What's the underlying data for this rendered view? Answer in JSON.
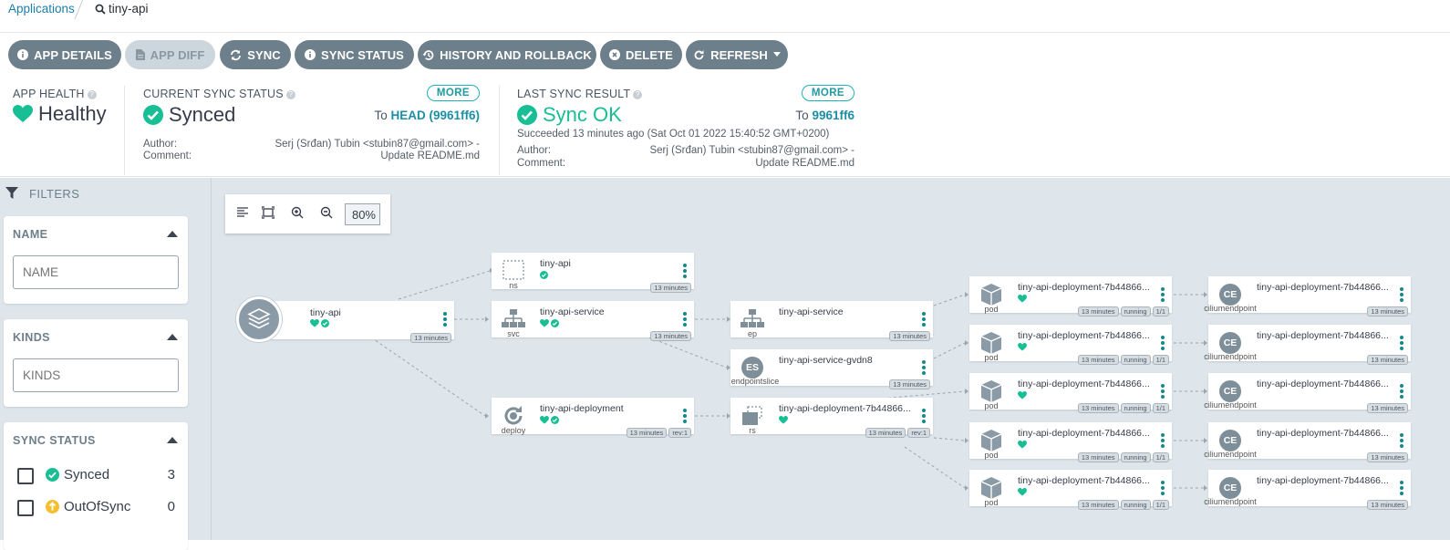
{
  "breadcrumb": {
    "applications": "Applications",
    "current": "tiny-api"
  },
  "toolbar": {
    "app_details": "APP DETAILS",
    "app_diff": "APP DIFF",
    "sync": "SYNC",
    "sync_status": "SYNC STATUS",
    "history": "HISTORY AND ROLLBACK",
    "delete": "DELETE",
    "refresh": "REFRESH"
  },
  "health": {
    "label": "APP HEALTH",
    "value": "Healthy"
  },
  "current_sync": {
    "label": "CURRENT SYNC STATUS",
    "value": "Synced",
    "more": "MORE",
    "to_prefix": "To",
    "to_ref": "HEAD (9961ff6)",
    "author_label": "Author:",
    "author": "Serj (Srđan) Tubin <stubin87@gmail.com> -",
    "comment_label": "Comment:",
    "comment": "Update README.md"
  },
  "last_sync": {
    "label": "LAST SYNC RESULT",
    "value": "Sync OK",
    "more": "MORE",
    "to_prefix": "To",
    "to_ref": "9961ff6",
    "succeeded": "Succeeded 13 minutes ago (Sat Oct 01 2022 15:40:52 GMT+0200)",
    "author_label": "Author:",
    "author": "Serj (Srđan) Tubin <stubin87@gmail.com> -",
    "comment_label": "Comment:",
    "comment": "Update README.md"
  },
  "filters": {
    "title": "FILTERS",
    "name": {
      "title": "NAME",
      "placeholder": "NAME"
    },
    "kinds": {
      "title": "KINDS",
      "placeholder": "KINDS"
    },
    "sync_status": {
      "title": "SYNC STATUS",
      "items": [
        {
          "label": "Synced",
          "count": "3"
        },
        {
          "label": "OutOfSync",
          "count": "0"
        }
      ]
    }
  },
  "zoom": "80%",
  "colors": {
    "accent": "#18be94",
    "button": "#6d7f8b",
    "link": "#1c8fa6",
    "outofsync": "#f4c030"
  },
  "graph": {
    "app": {
      "name": "tiny-api",
      "age": "13 minutes"
    },
    "ns": {
      "name": "tiny-api",
      "kind": "ns",
      "age": "13 minutes"
    },
    "svc": {
      "name": "tiny-api-service",
      "kind": "svc",
      "age": "13 minutes"
    },
    "deploy": {
      "name": "tiny-api-deployment",
      "kind": "deploy",
      "age": "13 minutes",
      "rev": "rev:1"
    },
    "ep": {
      "name": "tiny-api-service",
      "kind": "ep",
      "age": "13 minutes"
    },
    "eps": {
      "name": "tiny-api-service-gvdn8",
      "kind": "endpointslice",
      "icon": "ES",
      "age": "13 minutes"
    },
    "rs": {
      "name": "tiny-api-deployment-7b44866...",
      "kind": "rs",
      "age": "13 minutes",
      "rev": "rev:1"
    },
    "pods": [
      {
        "name": "tiny-api-deployment-7b44866...",
        "kind": "pod",
        "age": "13 minutes",
        "state": "running",
        "ready": "1/1"
      },
      {
        "name": "tiny-api-deployment-7b44866...",
        "kind": "pod",
        "age": "13 minutes",
        "state": "running",
        "ready": "1/1"
      },
      {
        "name": "tiny-api-deployment-7b44866...",
        "kind": "pod",
        "age": "13 minutes",
        "state": "running",
        "ready": "1/1"
      },
      {
        "name": "tiny-api-deployment-7b44866...",
        "kind": "pod",
        "age": "13 minutes",
        "state": "running",
        "ready": "1/1"
      },
      {
        "name": "tiny-api-deployment-7b44866...",
        "kind": "pod",
        "age": "13 minutes",
        "state": "running",
        "ready": "1/1"
      }
    ],
    "ceps": [
      {
        "name": "tiny-api-deployment-7b44866...",
        "kind": "ciliumendpoint",
        "icon": "CE",
        "age": "13 minutes"
      },
      {
        "name": "tiny-api-deployment-7b44866...",
        "kind": "ciliumendpoint",
        "icon": "CE",
        "age": "13 minutes"
      },
      {
        "name": "tiny-api-deployment-7b44866...",
        "kind": "ciliumendpoint",
        "icon": "CE",
        "age": "13 minutes"
      },
      {
        "name": "tiny-api-deployment-7b44866...",
        "kind": "ciliumendpoint",
        "icon": "CE",
        "age": "13 minutes"
      },
      {
        "name": "tiny-api-deployment-7b44866...",
        "kind": "ciliumendpoint",
        "icon": "CE",
        "age": "13 minutes"
      }
    ]
  }
}
